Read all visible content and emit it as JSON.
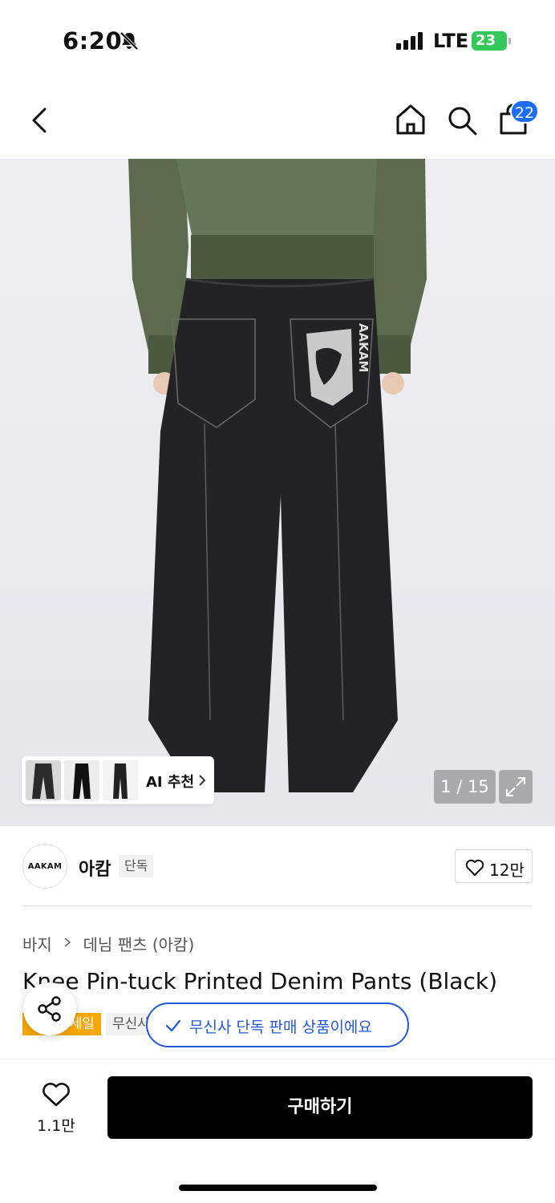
{
  "status_bar": {
    "time": "6:20",
    "network": "LTE",
    "battery": "23"
  },
  "nav": {
    "cart_count": "22"
  },
  "gallery": {
    "ai_label": "AI 추천",
    "counter": "1 / 15",
    "print_text": "AAKAM"
  },
  "brand": {
    "logo_text": "AAKAM",
    "name": "아캄",
    "tag": "단독",
    "likes": "12만"
  },
  "breadcrumb": {
    "category": "바지",
    "subcategory": "데님 팬츠 (아캄)"
  },
  "product": {
    "title": "Knee Pin-tuck Printed Denim Pants (Black)",
    "sale_badge": "세일",
    "musinsa_badge": "무신사"
  },
  "toast": {
    "text": "무신사 단독 판매 상품이에요"
  },
  "bottom": {
    "wish_count": "1.1만",
    "buy_label": "구매하기"
  },
  "colors": {
    "accent_blue": "#2258d8",
    "badge_blue": "#1c6cf5",
    "sale_orange": "#f7a700",
    "battery_green": "#34c759"
  }
}
